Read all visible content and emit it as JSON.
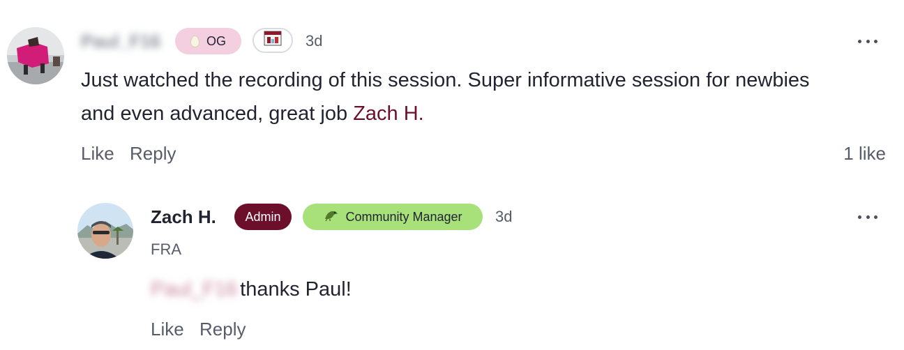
{
  "comment": {
    "author": "Paul_F16",
    "badge_og": "OG",
    "time": "3d",
    "text": "Just watched the recording of this session.  Super informative session for newbies and even advanced, great job ",
    "mention": "Zach H.",
    "like_label": "Like",
    "reply_label": "Reply",
    "likes": "1 like"
  },
  "reply": {
    "author": "Zach H.",
    "badge_admin": "Admin",
    "badge_role": "Community Manager",
    "time": "3d",
    "location": "FRA",
    "mention": "Paul_F16",
    "text": "thanks Paul!",
    "like_label": "Like",
    "reply_label": "Reply"
  },
  "colors": {
    "admin_badge": "#6b0f2a",
    "role_badge": "#a8e07a",
    "og_badge": "#f3cfe0",
    "mention": "#6b0f2a"
  }
}
